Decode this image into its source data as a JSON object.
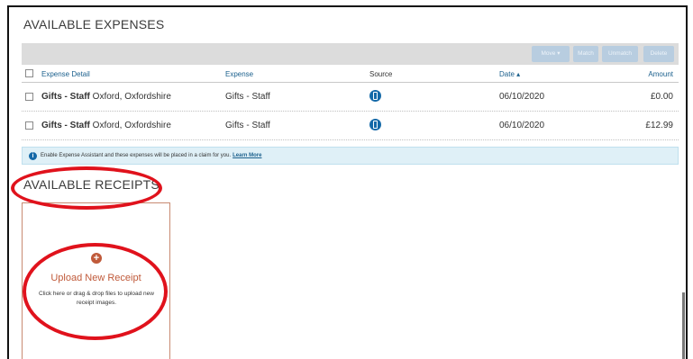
{
  "available_expenses": {
    "title": "AVAILABLE EXPENSES",
    "toolbar": {
      "buttons": [
        "Move ▾",
        "Match",
        "Unmatch",
        "Delete"
      ]
    },
    "columns": {
      "detail": "Expense Detail",
      "expense": "Expense",
      "source": "Source",
      "date": "Date ▴",
      "amount": "Amount"
    },
    "rows": [
      {
        "detail_bold": "Gifts - Staff",
        "detail_rest": " Oxford, Oxfordshire",
        "expense": "Gifts - Staff",
        "source_icon": "mobile-phone-icon",
        "date": "06/10/2020",
        "amount": "£0.00"
      },
      {
        "detail_bold": "Gifts - Staff",
        "detail_rest": " Oxford, Oxfordshire",
        "expense": "Gifts - Staff",
        "source_icon": "mobile-phone-icon",
        "date": "06/10/2020",
        "amount": "£12.99"
      }
    ]
  },
  "info_banner": {
    "text": "Enable Expense Assistant and these expenses will be placed in a claim for you.",
    "link": "Learn More"
  },
  "available_receipts": {
    "title": "AVAILABLE RECEIPTS",
    "upload": {
      "title": "Upload New Receipt",
      "description": "Click here or drag & drop files to upload new receipt images."
    }
  },
  "colors": {
    "annotation_red": "#e0121c",
    "link_blue": "#1a5f8c",
    "upload_accent": "#c05a3a"
  }
}
